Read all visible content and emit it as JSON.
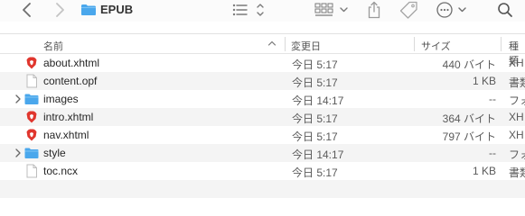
{
  "window": {
    "title": "EPUB"
  },
  "columns": {
    "name": "名前",
    "date": "変更日",
    "size": "サイズ",
    "kind": "種類"
  },
  "files": [
    {
      "name": "about.xhtml",
      "date": "今日 5:17",
      "size": "440 バイト",
      "kind": "XH",
      "icon": "brave-html-icon",
      "folder": false
    },
    {
      "name": "content.opf",
      "date": "今日 5:17",
      "size": "1 KB",
      "kind": "書類",
      "icon": "document-icon",
      "folder": false
    },
    {
      "name": "images",
      "date": "今日 14:17",
      "size": "--",
      "kind": "フォ",
      "icon": "folder-icon",
      "folder": true
    },
    {
      "name": "intro.xhtml",
      "date": "今日 5:17",
      "size": "364 バイト",
      "kind": "XH",
      "icon": "brave-html-icon",
      "folder": false
    },
    {
      "name": "nav.xhtml",
      "date": "今日 5:17",
      "size": "797 バイト",
      "kind": "XH",
      "icon": "brave-html-icon",
      "folder": false
    },
    {
      "name": "style",
      "date": "今日 14:17",
      "size": "--",
      "kind": "フォ",
      "icon": "folder-icon",
      "folder": true
    },
    {
      "name": "toc.ncx",
      "date": "今日 5:17",
      "size": "1 KB",
      "kind": "書類",
      "icon": "document-icon",
      "folder": false
    }
  ],
  "colors": {
    "folder": "#4aa7ec",
    "brave": "#e0362e",
    "alt_row": "#f4f4f4",
    "toolbar_icon": "#7a7a7a"
  }
}
